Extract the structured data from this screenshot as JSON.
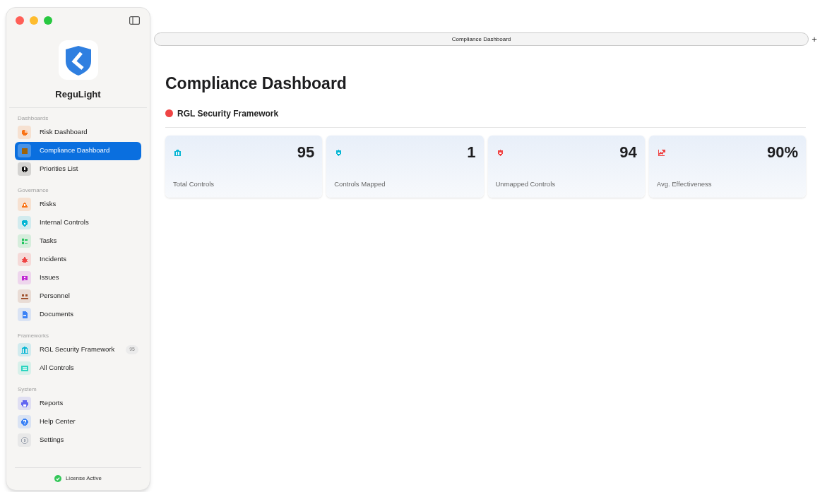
{
  "app": {
    "name": "ReguLight"
  },
  "sidebar": {
    "sections": [
      {
        "title": "Dashboards",
        "items": [
          {
            "label": "Risk Dashboard",
            "kind": "pie",
            "color": "#f97316",
            "selected": false
          },
          {
            "label": "Compliance Dashboard",
            "kind": "check",
            "color": "#a16207",
            "selected": true
          },
          {
            "label": "Priorities List",
            "kind": "alert",
            "color": "#111111",
            "selected": false
          }
        ]
      },
      {
        "title": "Governance",
        "items": [
          {
            "label": "Risks",
            "kind": "warning",
            "color": "#f97316",
            "selected": false
          },
          {
            "label": "Internal Controls",
            "kind": "shield",
            "color": "#06b6d4",
            "selected": false
          },
          {
            "label": "Tasks",
            "kind": "list",
            "color": "#22c55e",
            "selected": false
          },
          {
            "label": "Incidents",
            "kind": "bug",
            "color": "#ef4444",
            "selected": false
          },
          {
            "label": "Issues",
            "kind": "bubble",
            "color": "#c026d3",
            "selected": false
          },
          {
            "label": "Personnel",
            "kind": "people",
            "color": "#a0522d",
            "selected": false
          },
          {
            "label": "Documents",
            "kind": "doc",
            "color": "#3b82f6",
            "selected": false
          }
        ]
      },
      {
        "title": "Frameworks",
        "items": [
          {
            "label": "RGL Security Framework",
            "kind": "bank",
            "color": "#06b6d4",
            "selected": false,
            "badge": "95"
          },
          {
            "label": "All Controls",
            "kind": "panel",
            "color": "#2dd4bf",
            "selected": false
          }
        ]
      },
      {
        "title": "System",
        "items": [
          {
            "label": "Reports",
            "kind": "printer",
            "color": "#6366f1",
            "selected": false
          },
          {
            "label": "Help Center",
            "kind": "help",
            "color": "#3b82f6",
            "selected": false
          },
          {
            "label": "Settings",
            "kind": "gear",
            "color": "#9ca3af",
            "selected": false
          }
        ]
      }
    ]
  },
  "license": {
    "label": "License Active"
  },
  "tab_bar": {
    "tab": "Compliance Dashboard",
    "new_tab": "+"
  },
  "page": {
    "title": "Compliance Dashboard",
    "framework": {
      "name": "RGL Security Framework",
      "color": "#ef4444"
    },
    "cards": [
      {
        "value": "95",
        "label": "Total Controls",
        "kind": "bank",
        "color": "#06b6d4"
      },
      {
        "value": "1",
        "label": "Controls Mapped",
        "kind": "shield",
        "color": "#06b6d4"
      },
      {
        "value": "94",
        "label": "Unmapped Controls",
        "kind": "shield",
        "color": "#ef4444"
      },
      {
        "value": "90%",
        "label": "Avg. Effectiveness",
        "kind": "chart",
        "color": "#ef4444"
      }
    ]
  }
}
